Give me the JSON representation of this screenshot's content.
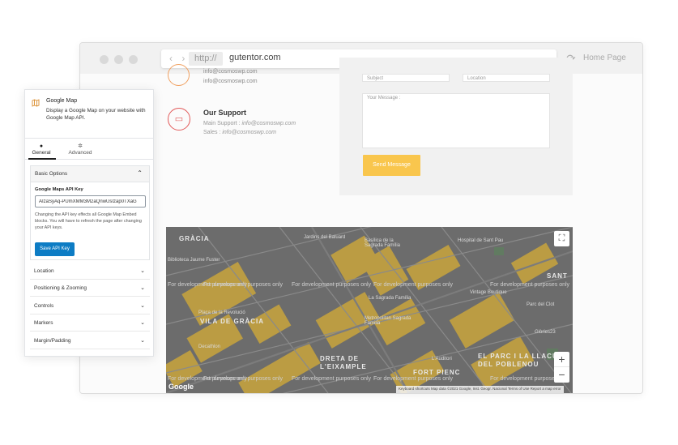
{
  "browser": {
    "nav_arrows": "‹ ›",
    "protocol": "http://",
    "domain": "gutentor.com",
    "refresh_icon": "refresh-icon",
    "home_link": "Home Page"
  },
  "contact": {
    "email_lines": [
      "info@cosmoswp.com",
      "info@cosmoswp.com"
    ],
    "support": {
      "title": "Our Support",
      "main_label": "Main Support : ",
      "main_email": "info@cosmoswp.com",
      "sales_label": "Sales : ",
      "sales_email": "info@cosmoswp.com"
    }
  },
  "form": {
    "subject_placeholder": "Subject",
    "location_placeholder": "Location",
    "message_placeholder": "Your Message :",
    "send_label": "Send Message"
  },
  "map": {
    "watermark": "For development purposes only",
    "districts": [
      "GRÀCIA",
      "VILA DE GRÀCIA",
      "DRETA DE L'EIXAMPLE",
      "FORT PIENC",
      "EL PARC I LA LLACUNA DEL POBLENOU",
      "SANT"
    ],
    "pois": [
      "Jardins del Baluard",
      "Basílica de la Sagrada Família",
      "Plaça de la Revolució",
      "Decathlon",
      "Metropolitan Sagrada Familia",
      "L'Auditori",
      "Glòries23",
      "Parc del Clot",
      "Vintage Boutique",
      "Biblioteca Jaume Fuster",
      "Hospital de Sant Pau",
      "La Sagrada Família"
    ],
    "fullscreen_icon": "fullscreen-icon",
    "zoom_in": "+",
    "zoom_out": "−",
    "google_logo": "Google",
    "attribution": "Keyboard shortcuts   Map data ©2021 Google, Inst. Geogr. Nacional   Terms of Use   Report a map error"
  },
  "panel": {
    "block_title": "Google Map",
    "block_description": "Display a Google Map on your website with Google Map API.",
    "tabs": [
      {
        "label": "General",
        "icon": "general-icon"
      },
      {
        "label": "Advanced",
        "icon": "gear-icon"
      }
    ],
    "basic_options": {
      "title": "Basic Options",
      "api_label": "Google Maps API Key",
      "api_value": "AIzaSyAq-PUmXMM3M2aQnwUsIzap0TXaG",
      "help_text": "Changing the API key effects all Google Map Embed blocks. You will have to refresh the page after changing your API keys.",
      "save_label": "Save API Key"
    },
    "sections": [
      "Location",
      "Positioning & Zooming",
      "Controls",
      "Markers",
      "Margin/Padding"
    ]
  },
  "colors": {
    "accent_yellow": "#f9c64d",
    "support_red": "#e25a5a",
    "save_blue": "#0d7cc4",
    "map_gray": "#6c6c6c",
    "map_yellow": "#c9a53c"
  }
}
